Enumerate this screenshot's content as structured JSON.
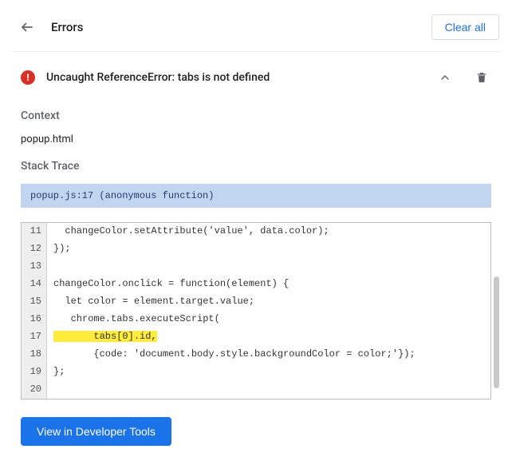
{
  "header": {
    "title": "Errors",
    "clear_label": "Clear all"
  },
  "error": {
    "message": "Uncaught ReferenceError: tabs is not defined"
  },
  "context": {
    "label": "Context",
    "value": "popup.html"
  },
  "stack_trace": {
    "label": "Stack Trace",
    "banner": "popup.js:17 (anonymous function)"
  },
  "code": {
    "lines": [
      {
        "n": 11,
        "t": "  changeColor.setAttribute('value', data.color);",
        "hl": false
      },
      {
        "n": 12,
        "t": "});",
        "hl": false
      },
      {
        "n": 13,
        "t": "",
        "hl": false
      },
      {
        "n": 14,
        "t": "changeColor.onclick = function(element) {",
        "hl": false
      },
      {
        "n": 15,
        "t": "  let color = element.target.value;",
        "hl": false
      },
      {
        "n": 16,
        "t": "   chrome.tabs.executeScript(",
        "hl": false
      },
      {
        "n": 17,
        "t": "       tabs[0].id,",
        "hl": true
      },
      {
        "n": 18,
        "t": "       {code: 'document.body.style.backgroundColor = color;'});",
        "hl": false
      },
      {
        "n": 19,
        "t": "};",
        "hl": false
      },
      {
        "n": 20,
        "t": "",
        "hl": false
      }
    ]
  },
  "footer": {
    "view_label": "View in Developer Tools"
  }
}
